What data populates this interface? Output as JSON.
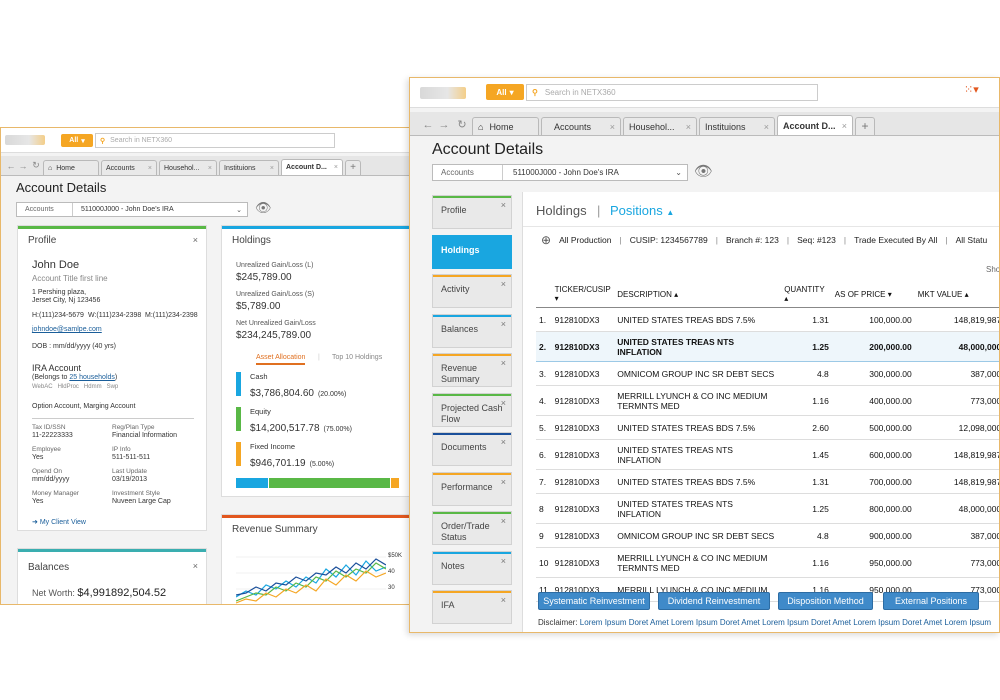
{
  "back": {
    "search_button": "All",
    "search_placeholder": "Search in NETX360",
    "tabs": [
      "Home",
      "Accounts",
      "Househol...",
      "Instituions",
      "Account D..."
    ],
    "title": "Account Details",
    "account_label": "Accounts",
    "account_value": "511000J000 - John Doe's IRA",
    "profile": {
      "header": "Profile",
      "name": "John Doe",
      "account_title": "Account Title first line",
      "address1": "1 Pershing plaza,",
      "address2": "Jerset City, Nj 123456",
      "phone_h": "H:(111)234-5679",
      "phone_w": "W:(111)234-2398",
      "phone_m": "M:(111)234-2398",
      "email": "johndoe@samlpe.com",
      "dob": "DOB : mm/dd/yyyy (40 yrs)",
      "ira_title": "IRA Account",
      "belongs_prefix": "(Belongs to ",
      "belongs_link": "25 households",
      "belongs_suffix": ")",
      "flags": "WebAC   HldProc   Hdmm   Swp",
      "option_text": "Option Account, Marging Account",
      "fields": [
        {
          "label": "Tax ID/SSN",
          "value": "11-22223333"
        },
        {
          "label": "Reg/Plan Type",
          "value": "Financial Information"
        },
        {
          "label": "Employee",
          "value": "Yes"
        },
        {
          "label": "IP Info",
          "value": "511-511-511"
        },
        {
          "label": "Opend On",
          "value": "mm/dd/yyyy"
        },
        {
          "label": "Last Update",
          "value": "03/19/2013"
        },
        {
          "label": "Money Manager",
          "value": "Yes"
        },
        {
          "label": "Investment Style",
          "value": "Nuveen Large Cap"
        }
      ],
      "client_view": "My Client View"
    },
    "holdings": {
      "header": "Holdings",
      "unrealized_l_label": "Unrealized Gain/Loss (L)",
      "unrealized_l_value": "$245,789.00",
      "unrealized_s_label": "Unrealized Gain/Loss (S)",
      "unrealized_s_value": "$5,789.00",
      "net_label": "Net Unrealized Gain/Loss",
      "net_value": "$234,245,789.00",
      "tab_asset": "Asset Allocation",
      "tab_top": "Top 10 Holdings",
      "items": [
        {
          "label": "Cash",
          "value": "$3,786,804.60",
          "pct": "(20.00%)",
          "color": "#19a6e0"
        },
        {
          "label": "Equity",
          "value": "$14,200,517.78",
          "pct": "(75.00%)",
          "color": "#59b846"
        },
        {
          "label": "Fixed Income",
          "value": "$946,701.19",
          "pct": "(5.00%)",
          "color": "#f5a623"
        }
      ],
      "alloc_fractions": [
        0.2,
        0.75,
        0.05
      ]
    },
    "balances": {
      "header": "Balances",
      "net_worth_label": "Net Worth:",
      "net_worth_value": "$4,991892,504.52"
    },
    "revenue": {
      "header": "Revenue Summary",
      "y_labels": [
        "$50K",
        "40",
        "30"
      ]
    }
  },
  "front": {
    "search_button": "All",
    "search_placeholder": "Search in NETX360",
    "tabs": [
      "Home",
      "Accounts",
      "Househol...",
      "Instituions",
      "Account D..."
    ],
    "title": "Account Details",
    "account_label": "Accounts",
    "account_value": "511000J000 - John Doe's IRA",
    "sidebar": [
      {
        "label": "Profile",
        "color": "#59b846",
        "active": false
      },
      {
        "label": "Holdings",
        "color": "#19a6e0",
        "active": true
      },
      {
        "label": "Activity",
        "color": "#f5a623",
        "active": false
      },
      {
        "label": "Balances",
        "color": "#19a6e0",
        "active": false
      },
      {
        "label": "Revenue Summary",
        "color": "#f5a623",
        "active": false
      },
      {
        "label": "Projected Cash Flow",
        "color": "#59b846",
        "active": false
      },
      {
        "label": "Documents",
        "color": "#1a4f9a",
        "active": false
      },
      {
        "label": "Performance",
        "color": "#f5a623",
        "active": false
      },
      {
        "label": "Order/Trade Status",
        "color": "#59b846",
        "active": false
      },
      {
        "label": "Notes",
        "color": "#19a6e0",
        "active": false
      },
      {
        "label": "IFA",
        "color": "#f5a623",
        "active": false
      }
    ],
    "crumb_holdings": "Holdings",
    "crumb_sep": "|",
    "crumb_positions": "Positions",
    "filter": {
      "production": "All Production",
      "cusip": "CUSIP: 1234567789",
      "branch": "Branch #: 123",
      "seq": "Seq: #123",
      "trade": "Trade Executed By All",
      "status": "All Statu"
    },
    "show_label": "Sho",
    "columns": [
      "TICKER/CUSIP",
      "DESCRIPTION",
      "QUANTITY",
      "AS OF PRICE",
      "MKT VALUE"
    ],
    "rows": [
      {
        "n": "1.",
        "cusip": "912810DX3",
        "desc": "UNITED STATES TREAS BDS 7.5%",
        "qty": "1.31",
        "price": "100,000.00",
        "mkt": "148,819,987.00"
      },
      {
        "n": "2.",
        "cusip": "912810DX3",
        "desc": "UNITED STATES TREAS NTS INFLATION",
        "qty": "1.25",
        "price": "200,000.00",
        "mkt": "48,000,000.00"
      },
      {
        "n": "3.",
        "cusip": "912810DX3",
        "desc": "OMNICOM GROUP INC SR DEBT SECS",
        "qty": "4.8",
        "price": "300,000.00",
        "mkt": "387,000.00"
      },
      {
        "n": "4.",
        "cusip": "912810DX3",
        "desc": "MERRILL LYUNCH & CO INC MEDIUM TERMNTS MED",
        "qty": "1.16",
        "price": "400,000.00",
        "mkt": "773,000.00"
      },
      {
        "n": "5.",
        "cusip": "912810DX3",
        "desc": "UNITED STATES TREAS BDS 7.5%",
        "qty": "2.60",
        "price": "500,000.00",
        "mkt": "12,098,000.00"
      },
      {
        "n": "6.",
        "cusip": "912810DX3",
        "desc": "UNITED STATES TREAS NTS INFLATION",
        "qty": "1.45",
        "price": "600,000.00",
        "mkt": "148,819,987.00"
      },
      {
        "n": "7.",
        "cusip": "912810DX3",
        "desc": "UNITED STATES TREAS BDS 7.5%",
        "qty": "1.31",
        "price": "700,000.00",
        "mkt": "148,819,987.00"
      },
      {
        "n": "8",
        "cusip": "912810DX3",
        "desc": "UNITED STATES TREAS NTS INFLATION",
        "qty": "1.25",
        "price": "800,000.00",
        "mkt": "48,000,000.00"
      },
      {
        "n": "9",
        "cusip": "912810DX3",
        "desc": "OMNICOM GROUP INC SR DEBT SECS",
        "qty": "4.8",
        "price": "900,000.00",
        "mkt": "387,000.00"
      },
      {
        "n": "10",
        "cusip": "912810DX3",
        "desc": "MERRILL LYUNCH & CO INC MEDIUM TERMNTS MED",
        "qty": "1.16",
        "price": "950,000.00",
        "mkt": "773,000.00"
      },
      {
        "n": "11",
        "cusip": "912810DX3",
        "desc": "MERRILL LYUNCH & CO INC MEDIUM",
        "qty": "1.16",
        "price": "950,000.00",
        "mkt": "773,000.00"
      }
    ],
    "buttons": [
      "Systematic Reinvestment",
      "Dividend Reinvestment",
      "Disposition Method",
      "External Positions"
    ],
    "disclaimer_label": "Disclaimer:",
    "disclaimer_text": "Lorem Ipsum Doret Amet Lorem Ipsum Doret Amet Lorem Ipsum Doret Amet Lorem Ipsum Doret Amet Lorem Ipsum"
  }
}
